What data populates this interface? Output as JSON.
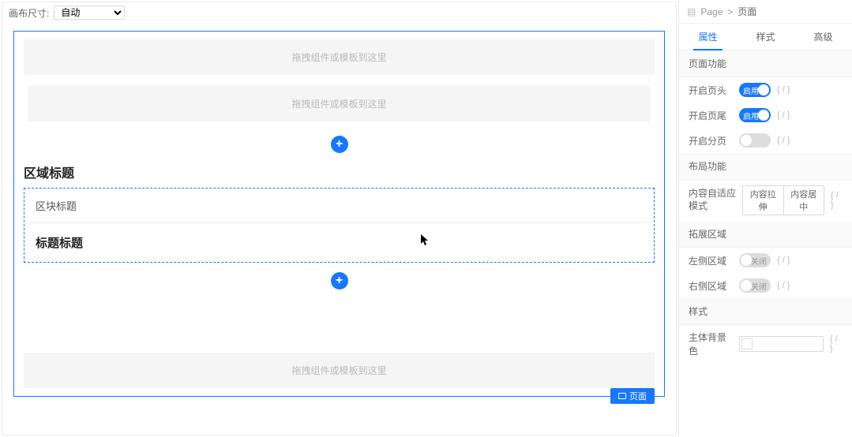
{
  "toolbar": {
    "canvasSizeLabel": "画布尺寸:",
    "canvasSizeValue": "自动"
  },
  "canvas": {
    "dropzonePlaceholder": "拖拽组件或模板到这里",
    "regionTitle": "区域标题",
    "blockHeader": "区块标题",
    "blockTitle": "标题标题",
    "pageTag": "页面"
  },
  "breadcrumb": {
    "page": "Page",
    "sep": ">",
    "current": "页面"
  },
  "tabs": {
    "props": "属性",
    "style": "样式",
    "advanced": "高级"
  },
  "sections": {
    "pageFunc": "页面功能",
    "layoutFunc": "布局功能",
    "extArea": "拓展区域",
    "styleSec": "样式"
  },
  "props": {
    "enableHeader": {
      "label": "开启页头",
      "text": "启用"
    },
    "enableFooter": {
      "label": "开启页尾",
      "text": "启用"
    },
    "enablePaging": {
      "label": "开启分页",
      "text": ""
    },
    "contentAdaptive": {
      "label": "内容自适应模式",
      "opt1": "内容拉伸",
      "opt2": "内容居中"
    },
    "leftArea": {
      "label": "左侧区域",
      "text": "关闭"
    },
    "rightArea": {
      "label": "右侧区域",
      "text": "关闭"
    },
    "bodyBg": {
      "label": "主体背景色"
    },
    "expr": "{ / }"
  }
}
